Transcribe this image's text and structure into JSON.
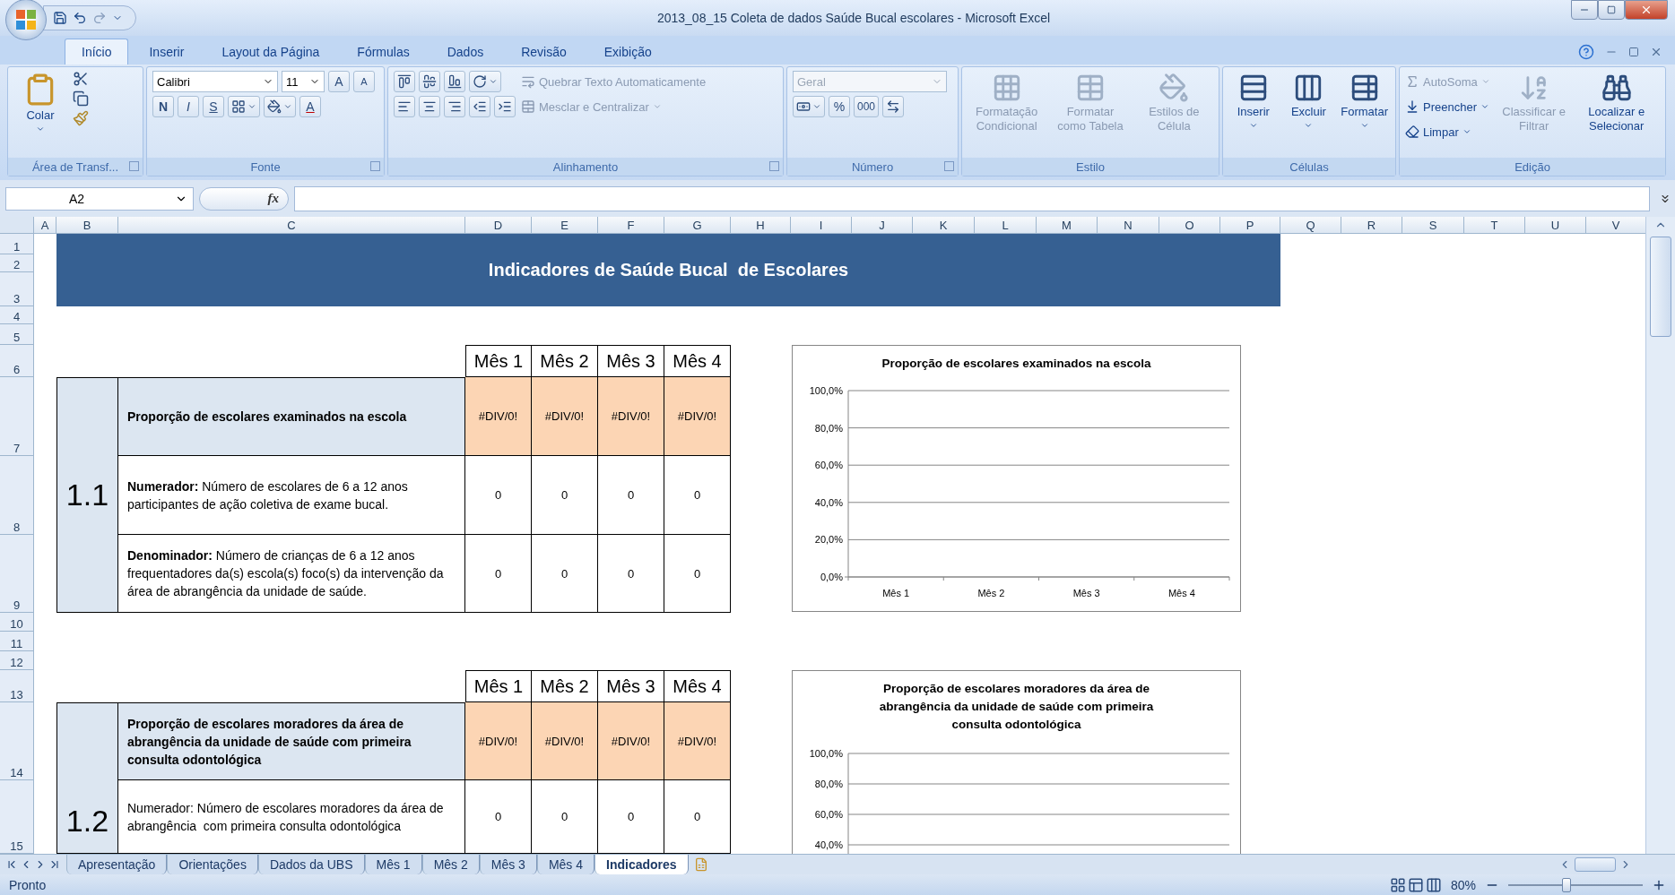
{
  "window": {
    "title": "2013_08_15 Coleta de dados Saúde Bucal escolares - Microsoft Excel"
  },
  "ribbon": {
    "tabs": [
      {
        "label": "Início",
        "selected": true
      },
      {
        "label": "Inserir",
        "selected": false
      },
      {
        "label": "Layout da Página",
        "selected": false
      },
      {
        "label": "Fórmulas",
        "selected": false
      },
      {
        "label": "Dados",
        "selected": false
      },
      {
        "label": "Revisão",
        "selected": false
      },
      {
        "label": "Exibição",
        "selected": false
      }
    ],
    "clipboard": {
      "paste": "Colar",
      "label": "Área de Transf..."
    },
    "font": {
      "name": "Calibri",
      "size": "11",
      "grow": "A",
      "shrink": "A",
      "bold": "N",
      "italic": "I",
      "underline": "S",
      "text_color_button": "A",
      "label": "Fonte"
    },
    "alignment": {
      "wrap": {
        "label": "Quebrar Texto Automaticamente",
        "disabled": true
      },
      "merge": {
        "label": "Mesclar e Centralizar",
        "disabled": true
      },
      "label": "Alinhamento"
    },
    "number": {
      "format": {
        "value": "Geral",
        "disabled": true
      },
      "percent": "%",
      "thousands": "000",
      "label": "Número"
    },
    "styles": {
      "buttons": [
        {
          "label": "Formatação Condicional",
          "disabled": true
        },
        {
          "label": "Formatar como Tabela",
          "disabled": true
        },
        {
          "label": "Estilos de Célula",
          "disabled": true
        }
      ],
      "label": "Estilo"
    },
    "cells": {
      "buttons": [
        {
          "label": "Inserir",
          "disabled": false
        },
        {
          "label": "Excluir",
          "disabled": false
        },
        {
          "label": "Formatar",
          "disabled": false
        }
      ],
      "label": "Células"
    },
    "editing": {
      "small": [
        {
          "label": "AutoSoma",
          "disabled": true
        },
        {
          "label": "Preencher",
          "disabled": false
        },
        {
          "label": "Limpar",
          "disabled": false
        }
      ],
      "large": [
        {
          "label": "Classificar e Filtrar",
          "disabled": true
        },
        {
          "label": "Localizar e Selecionar",
          "disabled": false
        }
      ],
      "label": "Edição"
    }
  },
  "formula_bar": {
    "name_box": "A2",
    "function_label": "fx"
  },
  "sheet": {
    "columns": [
      "A",
      "B",
      "C",
      "D",
      "E",
      "F",
      "G",
      "H",
      "I",
      "J",
      "K",
      "L",
      "M",
      "N",
      "O",
      "P",
      "Q",
      "R",
      "S",
      "T",
      "U",
      "V"
    ],
    "rows": [
      "1",
      "2",
      "3",
      "4",
      "5",
      "6",
      "7",
      "8",
      "9",
      "10",
      "11",
      "12",
      "13",
      "14",
      "15"
    ],
    "title": "Indicadores de Saúde Bucal  de Escolares",
    "tables": [
      {
        "id": "1.1",
        "months": [
          "Mês 1",
          "Mês 2",
          "Mês 3",
          "Mês 4"
        ],
        "rows": [
          {
            "kind": "indicator",
            "text": "Proporção de escolares examinados na escola",
            "values": [
              "#DIV/0!",
              "#DIV/0!",
              "#DIV/0!",
              "#DIV/0!"
            ]
          },
          {
            "kind": "detail",
            "text": "**Numerador:** Número de escolares de 6 a 12 anos participantes de ação coletiva de exame bucal.",
            "values": [
              "0",
              "0",
              "0",
              "0"
            ]
          },
          {
            "kind": "detail",
            "text": "**Denominador:** Número de crianças de 6 a 12 anos frequentadores da(s) escola(s) foco(s) da intervenção da área de abrangência da unidade de saúde.",
            "values": [
              "0",
              "0",
              "0",
              "0"
            ]
          }
        ]
      },
      {
        "id": "1.2",
        "months": [
          "Mês 1",
          "Mês 2",
          "Mês 3",
          "Mês 4"
        ],
        "rows": [
          {
            "kind": "indicator",
            "text": "Proporção de escolares moradores da área de abrangência da unidade de saúde com primeira consulta odontológica",
            "values": [
              "#DIV/0!",
              "#DIV/0!",
              "#DIV/0!",
              "#DIV/0!"
            ]
          },
          {
            "kind": "detail",
            "text": "Numerador: Número de escolares moradores da área de abrangência  com primeira consulta odontológica",
            "values": [
              "0",
              "0",
              "0",
              "0"
            ]
          }
        ]
      }
    ],
    "charts": [
      {
        "chart_data": {
          "type": "bar",
          "title": "Proporção de escolares examinados na escola",
          "categories": [
            "Mês 1",
            "Mês 2",
            "Mês 3",
            "Mês 4"
          ],
          "values": [
            null,
            null,
            null,
            null
          ],
          "ylim": [
            0,
            1
          ],
          "grid": true,
          "yticks": [
            {
              "value": 0,
              "label": "0,0%"
            },
            {
              "value": 0.2,
              "label": "20,0%"
            },
            {
              "value": 0.4,
              "label": "40,0%"
            },
            {
              "value": 0.6,
              "label": "60,0%"
            },
            {
              "value": 0.8,
              "label": "80,0%"
            },
            {
              "value": 1,
              "label": "100,0%"
            }
          ]
        }
      },
      {
        "chart_data": {
          "type": "bar",
          "title": "Proporção de escolares moradores da área de abrangência da unidade de saúde com primeira consulta odontológica",
          "values": [
            null,
            null,
            null,
            null
          ],
          "ylim": [
            0.4,
            1
          ],
          "grid": true,
          "yticks": [
            {
              "value": 0.4,
              "label": "40,0%"
            },
            {
              "value": 0.6,
              "label": "60,0%"
            },
            {
              "value": 0.8,
              "label": "80,0%"
            },
            {
              "value": 1,
              "label": "100,0%"
            }
          ]
        }
      }
    ]
  },
  "sheet_tabs": [
    {
      "label": "Apresentação",
      "selected": false
    },
    {
      "label": "Orientações",
      "selected": false
    },
    {
      "label": "Dados da UBS",
      "selected": false
    },
    {
      "label": "Mês 1",
      "selected": false
    },
    {
      "label": "Mês 2",
      "selected": false
    },
    {
      "label": "Mês 3",
      "selected": false
    },
    {
      "label": "Mês 4",
      "selected": false
    },
    {
      "label": "Indicadores",
      "selected": true
    }
  ],
  "status_bar": {
    "status": "Pronto",
    "zoom": "80%",
    "zoom_slider": {
      "level": 0.43
    }
  }
}
